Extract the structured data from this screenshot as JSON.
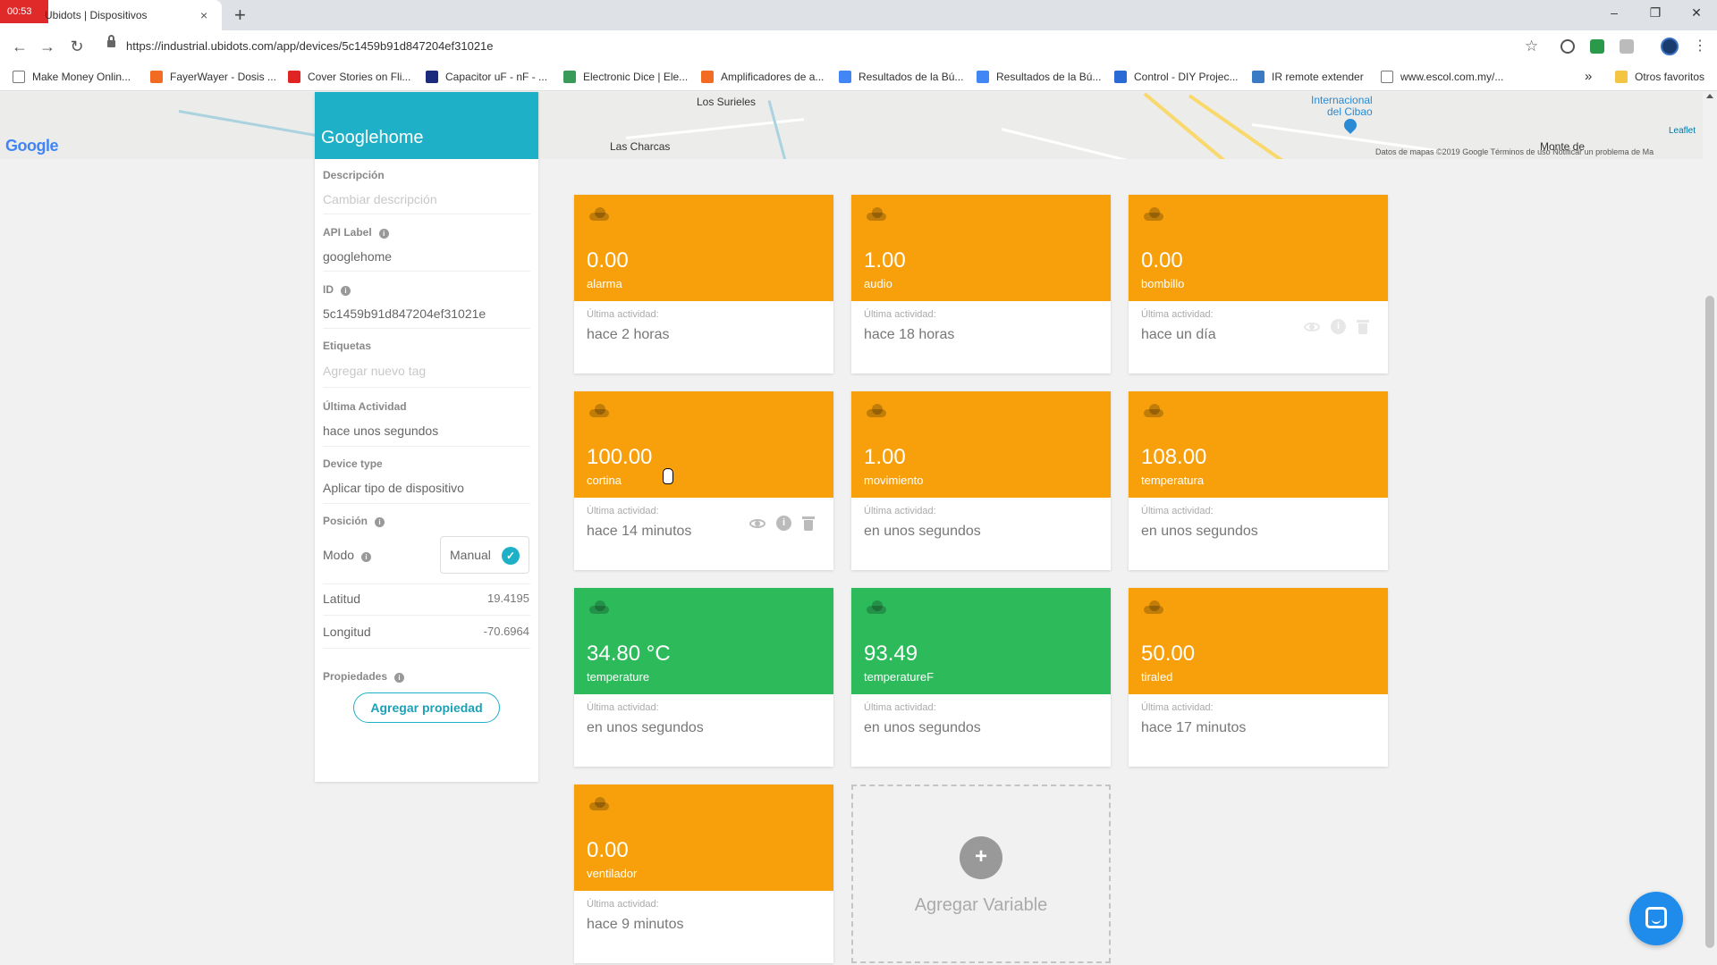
{
  "browser": {
    "recording_badge": "00:53",
    "tab_title": "Ubidots | Dispositivos",
    "tab_close": "×",
    "new_tab": "+",
    "url": "https://industrial.ubidots.com/app/devices/5c1459b91d847204ef31021e",
    "minimize": "–",
    "restore": "❐",
    "close": "✕",
    "back": "←",
    "forward": "→",
    "reload": "↻",
    "bookmark_star": "☆",
    "menu": "⋮",
    "bookmarks": [
      {
        "label": "Make Money Onlin...",
        "color": "#ffffff"
      },
      {
        "label": "FayerWayer - Dosis ...",
        "color": "#f26b22"
      },
      {
        "label": "Cover Stories on Fli...",
        "color": "#e02424"
      },
      {
        "label": "Capacitor uF - nF - ...",
        "color": "#1a2a7c"
      },
      {
        "label": "Electronic Dice | Ele...",
        "color": "#3a9a5a"
      },
      {
        "label": "Amplificadores de a...",
        "color": "#f26b22"
      },
      {
        "label": "Resultados de la Bú...",
        "color": "#4285f4"
      },
      {
        "label": "Resultados de la Bú...",
        "color": "#4285f4"
      },
      {
        "label": "Control - DIY Projec...",
        "color": "#2a6ad4"
      },
      {
        "label": "IR remote extender",
        "color": "#3a7ac4"
      },
      {
        "label": "www.escol.com.my/...",
        "color": "#ffffff"
      }
    ],
    "bookmarks_more": "»",
    "other_bookmarks": "Otros favoritos"
  },
  "map": {
    "places": [
      "Los Surieles",
      "Las Charcas",
      "Internacional",
      "del Cibao",
      "Monte de"
    ],
    "google_logo": "Google",
    "attribution": "Datos de mapas ©2019 Google   Términos de uso   Notificar un problema de Ma",
    "leaflet": "Leaflet"
  },
  "device": {
    "name": "Googlehome",
    "description_label": "Descripción",
    "description_placeholder": "Cambiar descripción",
    "api_label_label": "API Label",
    "api_label": "googlehome",
    "id_label": "ID",
    "id": "5c1459b91d847204ef31021e",
    "tags_label": "Etiquetas",
    "tags_placeholder": "Agregar nuevo tag",
    "last_activity_label": "Última Actividad",
    "last_activity": "hace unos segundos",
    "device_type_label": "Device type",
    "device_type": "Aplicar tipo de dispositivo",
    "position_label": "Posición",
    "mode_label": "Modo",
    "mode_value": "Manual",
    "mode_check": "✓",
    "latitude_label": "Latitud",
    "latitude": "19.4195",
    "longitude_label": "Longitud",
    "longitude": "-70.6964",
    "properties_label": "Propiedades",
    "add_property": "Agregar propiedad",
    "info_glyph": "i"
  },
  "cards_common": {
    "activity_label": "Última actividad:",
    "info_glyph": "i"
  },
  "variables": [
    {
      "value": "0.00",
      "name": "alarma",
      "activity": "hace 2 horas",
      "color": "orange"
    },
    {
      "value": "1.00",
      "name": "audio",
      "activity": "hace 18 horas",
      "color": "orange"
    },
    {
      "value": "0.00",
      "name": "bombillo",
      "activity": "hace un día",
      "color": "orange"
    },
    {
      "value": "100.00",
      "name": "cortina",
      "activity": "hace 14 minutos",
      "color": "orange"
    },
    {
      "value": "1.00",
      "name": "movimiento",
      "activity": "en unos segundos",
      "color": "orange"
    },
    {
      "value": "108.00",
      "name": "temperatura",
      "activity": "en unos segundos",
      "color": "orange"
    },
    {
      "value": "34.80 °C",
      "name": "temperature",
      "activity": "en unos segundos",
      "color": "green"
    },
    {
      "value": "93.49",
      "name": "temperatureF",
      "activity": "en unos segundos",
      "color": "green"
    },
    {
      "value": "50.00",
      "name": "tiraled",
      "activity": "hace 17 minutos",
      "color": "orange"
    },
    {
      "value": "0.00",
      "name": "ventilador",
      "activity": "hace 9 minutos",
      "color": "orange"
    }
  ],
  "add_variable": {
    "plus": "+",
    "label": "Agregar Variable"
  },
  "colors": {
    "device_header": "#1eb0c7",
    "card_orange": "#f8a00b",
    "card_green": "#2dba5b",
    "chat_button": "#1f8ceb"
  }
}
